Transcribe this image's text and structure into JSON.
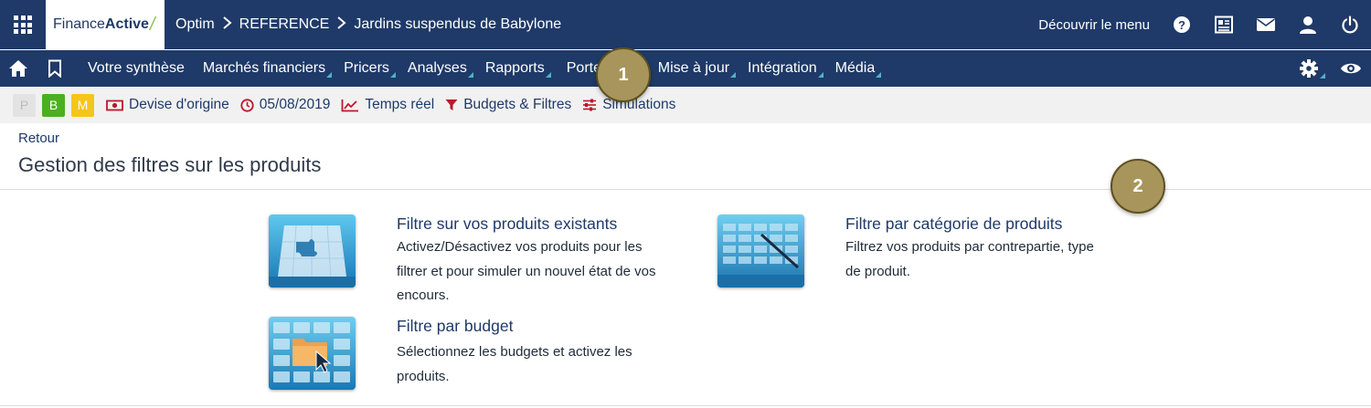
{
  "topbar": {
    "logo_main": "Finance",
    "logo_bold": "Active",
    "breadcrumb": [
      "Optim",
      "REFERENCE",
      "Jardins suspendus de Babylone"
    ],
    "discover_label": "Découvrir le menu"
  },
  "nav": {
    "items": [
      "Votre synthèse",
      "Marchés financiers",
      "Pricers",
      "Analyses",
      "Rapports",
      "Portefeuille",
      "Mise à jour",
      "Intégration",
      "Média"
    ]
  },
  "toolbar": {
    "scenario_buttons": [
      "P",
      "B",
      "M"
    ],
    "currency_label": "Devise d'origine",
    "date_label": "05/08/2019",
    "realtime_label": "Temps réel",
    "filters_label": "Budgets & Filtres",
    "simulations_label": "Simulations"
  },
  "page": {
    "back_label": "Retour",
    "title": "Gestion des filtres sur les produits"
  },
  "cards": [
    {
      "title": "Filtre sur vos produits existants",
      "desc_lines": [
        "Activez/Désactivez vos produits pour les",
        "filtrer et pour simuler un nouvel état de vos",
        "encours."
      ]
    },
    {
      "title": "Filtre par catégorie de produits",
      "desc_lines": [
        "Filtrez vos produits par contrepartie, type",
        "de produit."
      ]
    },
    {
      "title": "Filtre par budget",
      "desc_lines": [
        "Sélectionnez les budgets et activez les",
        "produits."
      ]
    }
  ],
  "callouts": [
    "1",
    "2"
  ],
  "colors": {
    "nav_bg": "#1f3a68",
    "accent_tri": "#4fb3c8",
    "callout": "#a8955c",
    "b_green": "#4caf20",
    "m_yellow": "#f5c518"
  }
}
